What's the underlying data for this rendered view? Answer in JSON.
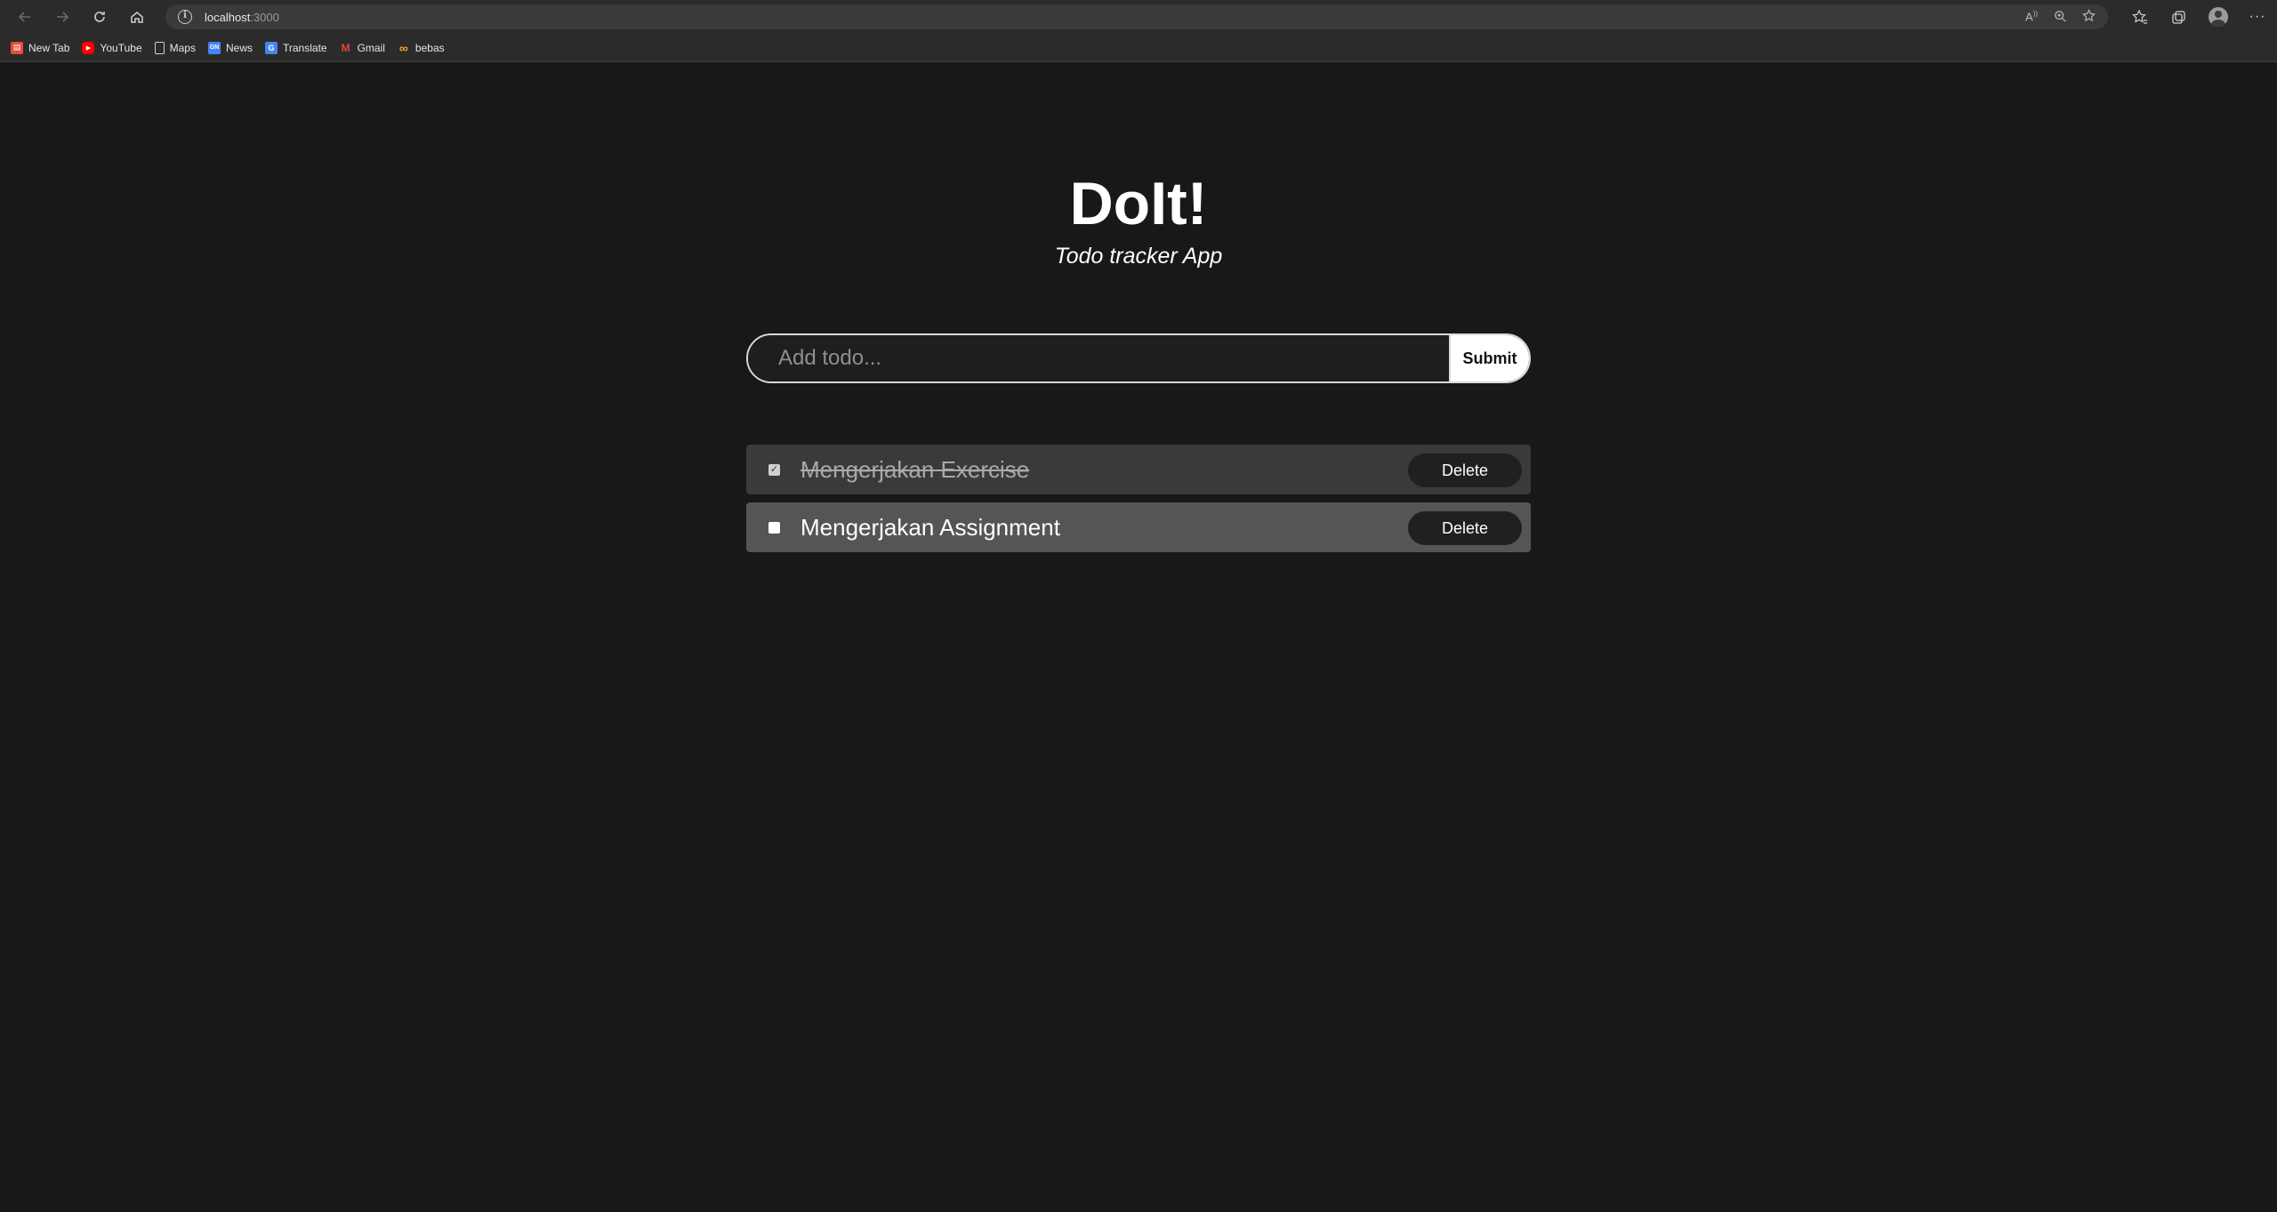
{
  "browser": {
    "url_host": "localhost",
    "url_port": ":3000",
    "bookmarks": [
      {
        "label": "New Tab",
        "icon": "new-tab-icon",
        "color": "#e8eaed"
      },
      {
        "label": "YouTube",
        "icon": "youtube-icon",
        "color": "#ff0000"
      },
      {
        "label": "Maps",
        "icon": "page-icon",
        "color": "#cfcfcf"
      },
      {
        "label": "News",
        "icon": "google-news-icon",
        "color": "#4285f4"
      },
      {
        "label": "Translate",
        "icon": "translate-icon",
        "color": "#4285f4"
      },
      {
        "label": "Gmail",
        "icon": "gmail-icon",
        "color": "#ea4335"
      },
      {
        "label": "bebas",
        "icon": "infinity-icon",
        "color": "#f5a623"
      }
    ]
  },
  "app": {
    "title": "DoIt!",
    "subtitle": "Todo tracker App",
    "input_placeholder": "Add todo...",
    "submit_label": "Submit",
    "todos": [
      {
        "text": "Mengerjakan Exercise",
        "done": true,
        "delete_label": "Delete"
      },
      {
        "text": "Mengerjakan Assignment",
        "done": false,
        "delete_label": "Delete"
      }
    ]
  },
  "colors": {
    "background": "#181818",
    "done_row": "#3a3a3a",
    "open_row": "#555555"
  }
}
